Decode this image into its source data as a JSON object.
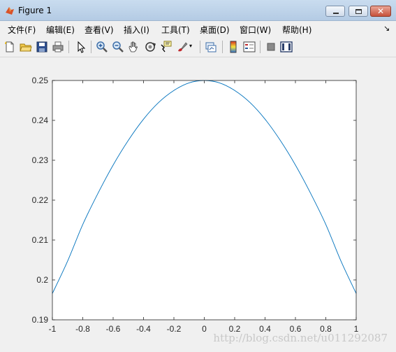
{
  "window": {
    "title": "Figure 1"
  },
  "menu": [
    "文件(F)",
    "编辑(E)",
    "查看(V)",
    "插入(I)",
    "工具(T)",
    "桌面(D)",
    "窗口(W)",
    "帮助(H)"
  ],
  "toolbar_icons": [
    "new-figure-icon",
    "open-file-icon",
    "save-icon",
    "print-icon",
    "pointer-icon",
    "zoom-in-icon",
    "zoom-out-icon",
    "pan-hand-icon",
    "rotate-3d-icon",
    "data-cursor-icon",
    "brush-icon",
    "link-plot-icon",
    "colorbar-icon",
    "legend-icon",
    "hide-plot-tools-icon",
    "show-plot-tools-icon"
  ],
  "chart_data": {
    "type": "line",
    "title": "",
    "xlabel": "",
    "ylabel": "",
    "xlim": [
      -1,
      1
    ],
    "ylim": [
      0.19,
      0.25
    ],
    "xticks": [
      "-1",
      "-0.8",
      "-0.6",
      "-0.4",
      "-0.2",
      "0",
      "0.2",
      "0.4",
      "0.6",
      "0.8",
      "1"
    ],
    "yticks": [
      "0.19",
      "0.2",
      "0.21",
      "0.22",
      "0.23",
      "0.24",
      "0.25"
    ],
    "grid": false,
    "line_color": "#0072bd",
    "series": [
      {
        "x": [
          -1,
          -0.9,
          -0.8,
          -0.7,
          -0.6,
          -0.5,
          -0.4,
          -0.3,
          -0.2,
          -0.1,
          0,
          0.1,
          0.2,
          0.3,
          0.4,
          0.5,
          0.6,
          0.7,
          0.8,
          0.9,
          1
        ],
        "values": [
          0.1966,
          0.2047,
          0.2139,
          0.2217,
          0.2288,
          0.235,
          0.2403,
          0.2445,
          0.2475,
          0.2494,
          0.25,
          0.2494,
          0.2475,
          0.2445,
          0.2403,
          0.235,
          0.2288,
          0.2217,
          0.2139,
          0.2047,
          0.1966
        ]
      }
    ]
  },
  "watermark": "http://blog.csdn.net/u011292087"
}
